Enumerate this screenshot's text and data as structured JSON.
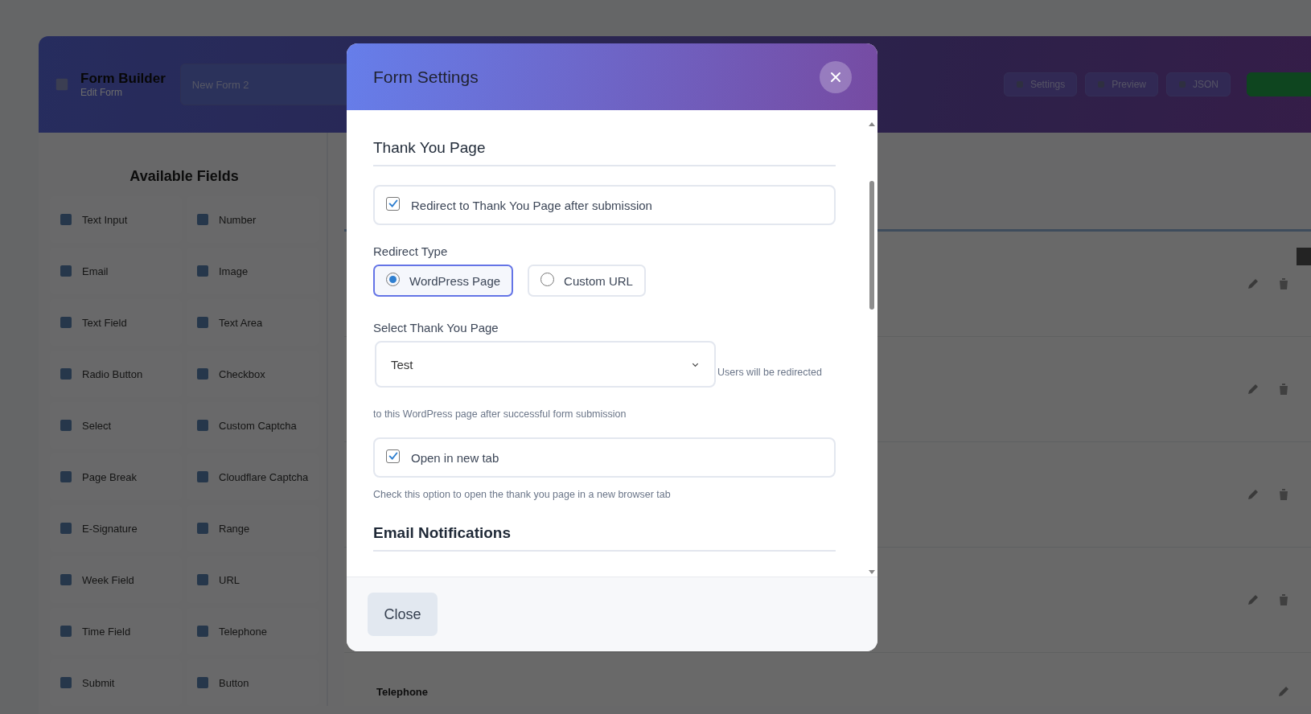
{
  "background": {
    "header": {
      "title": "Form Builder",
      "subtitle": "Edit Form",
      "form_name": "New Form 2",
      "buttons": [
        {
          "label": "Settings",
          "kind": "plain"
        },
        {
          "label": "Preview",
          "kind": "plain"
        },
        {
          "label": "JSON",
          "kind": "plain"
        },
        {
          "kind": "primary"
        }
      ]
    },
    "sidebar": {
      "title": "Available Fields",
      "fields": [
        {
          "label": "Text Input"
        },
        {
          "label": "Number"
        },
        {
          "label": "Email"
        },
        {
          "label": "Image"
        },
        {
          "label": "Text Field"
        },
        {
          "label": "Text Area"
        },
        {
          "label": "Radio Button"
        },
        {
          "label": "Checkbox"
        },
        {
          "label": "Select"
        },
        {
          "label": "Custom Captcha"
        },
        {
          "label": "Page Break"
        },
        {
          "label": "Cloudflare Captcha"
        },
        {
          "label": "E-Signature"
        },
        {
          "label": "Range"
        },
        {
          "label": "Week Field"
        },
        {
          "label": "URL"
        },
        {
          "label": "Time Field"
        },
        {
          "label": "Telephone"
        },
        {
          "label": "Submit"
        },
        {
          "label": "Button"
        }
      ]
    },
    "canvas": {
      "field_label": "Telephone"
    }
  },
  "modal": {
    "title": "Form Settings",
    "sections": [
      {
        "heading": "Thank You Page",
        "items": [
          {
            "kind": "checkbox",
            "label": "Redirect to Thank You Page after submission",
            "checked": true
          },
          {
            "kind": "radio",
            "label": "Redirect Type",
            "options": [
              {
                "label": "WordPress Page",
                "selected": true
              },
              {
                "label": "Custom URL",
                "selected": false
              }
            ]
          },
          {
            "kind": "select",
            "label": "Select Thank You Page",
            "value": "Test",
            "help_lines": [
              "Users will be redirected",
              "to this WordPress page after successful form submission"
            ]
          },
          {
            "kind": "checkbox",
            "label": "Open in new tab",
            "checked": true,
            "help": "Check this option to open the thank you page in a new browser tab"
          }
        ]
      },
      {
        "heading": "Email Notifications"
      }
    ],
    "footer_button": "Close"
  }
}
